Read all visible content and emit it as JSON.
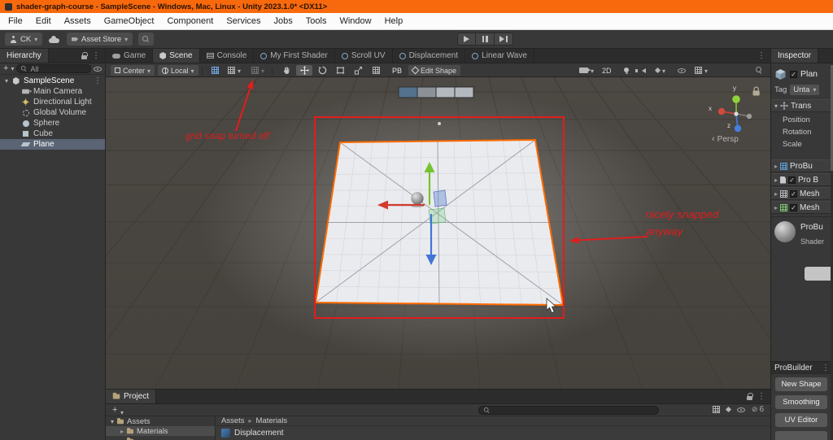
{
  "colors": {
    "titlebar": "#f8690d",
    "selection_outline": "#ff6b00",
    "annotation_red": "#e11d1d",
    "axis_x": "#d23b2e",
    "axis_y": "#76c32f",
    "axis_z": "#3f76d8"
  },
  "title_bar": {
    "title": "shader-graph-course - SampleScene - Windows, Mac, Linux - Unity 2023.1.0* <DX11>"
  },
  "menu": {
    "items": [
      "File",
      "Edit",
      "Assets",
      "GameObject",
      "Component",
      "Services",
      "Jobs",
      "Tools",
      "Window",
      "Help"
    ]
  },
  "toolbar": {
    "account": "CK",
    "asset_store": "Asset Store"
  },
  "hierarchy": {
    "title": "Hierarchy",
    "search_filter": "All",
    "scene_name": "SampleScene",
    "items": [
      {
        "label": "Main Camera"
      },
      {
        "label": "Directional Light"
      },
      {
        "label": "Global Volume"
      },
      {
        "label": "Sphere"
      },
      {
        "label": "Cube"
      },
      {
        "label": "Plane"
      }
    ]
  },
  "scene": {
    "tabs": [
      {
        "label": "Game"
      },
      {
        "label": "Scene"
      },
      {
        "label": "Console"
      },
      {
        "label": "My First Shader"
      },
      {
        "label": "Scroll UV"
      },
      {
        "label": "Displacement"
      },
      {
        "label": "Linear Wave"
      }
    ],
    "toolbar": {
      "pivot": "Center",
      "space": "Local",
      "pb": "PB",
      "edit_shape": "Edit Shape",
      "two_d": "2D"
    },
    "viewport": {
      "persp": "Persp",
      "axis_x": "x",
      "axis_y": "y",
      "axis_z": "z",
      "annotations": {
        "note1": "grid snap turned off",
        "note2_line1": "nicely snapped",
        "note2_line2": "anyway"
      }
    }
  },
  "inspector": {
    "title": "Inspector",
    "object_name": "Plan",
    "tag_label": "Tag",
    "tag_value": "Unta",
    "transform_title": "Trans",
    "transform_rows": [
      "Position",
      "Rotation",
      "Scale"
    ],
    "components": [
      {
        "label": "ProBu"
      },
      {
        "label": "Pro B"
      },
      {
        "label": "Mesh"
      },
      {
        "label": "Mesh"
      }
    ],
    "material_name": "ProBu",
    "material_shader": "Shader",
    "probuilder_title": "ProBuilder",
    "probuilder_buttons": [
      "New Shape",
      "Smoothing",
      "UV Editor"
    ]
  },
  "project": {
    "tab": "Project",
    "breadcrumb_root": "Assets",
    "breadcrumb_current": "Materials",
    "tree_root": "Assets",
    "tree_child": "Materials",
    "item_name": "Displacement",
    "hidden_count": "6"
  }
}
